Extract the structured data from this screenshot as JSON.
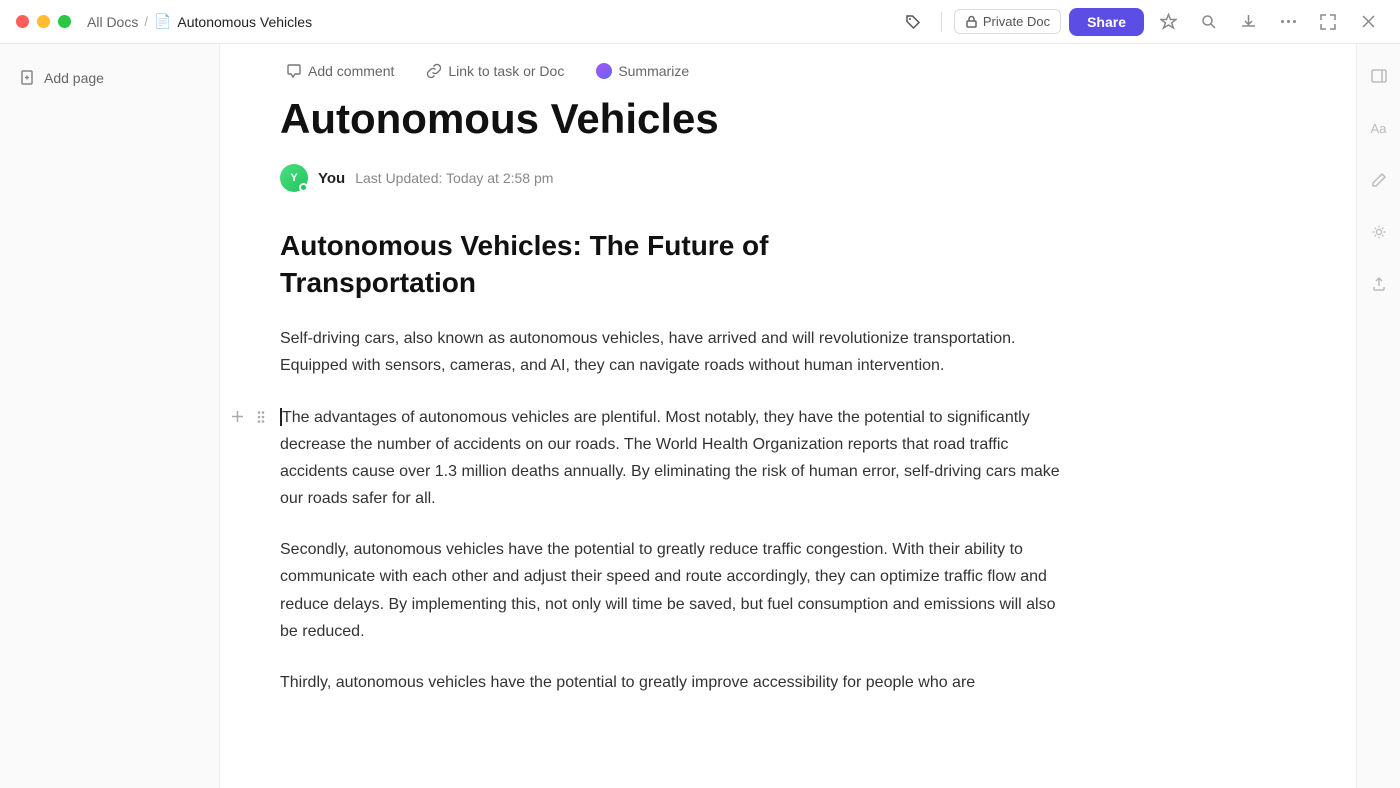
{
  "titlebar": {
    "breadcrumb_home": "All Docs",
    "breadcrumb_sep": "/",
    "doc_title": "Autonomous Vehicles",
    "private_doc_label": "Private Doc",
    "share_label": "Share"
  },
  "toolbar": {
    "add_comment": "Add comment",
    "link_to_task": "Link to task or Doc",
    "summarize": "Summarize"
  },
  "sidebar": {
    "add_page_label": "Add page"
  },
  "doc": {
    "title": "Autonomous Vehicles",
    "author": "You",
    "last_updated": "Last Updated: Today at 2:58 pm",
    "section_heading_line1": "Autonomous Vehicles: The Future of",
    "section_heading_line2": "Transportation",
    "paragraph1": "Self-driving cars, also known as autonomous vehicles, have arrived and will revolutionize transportation. Equipped with sensors, cameras, and AI, they can navigate roads without human intervention.",
    "paragraph2": "The advantages of autonomous vehicles are plentiful. Most notably, they have the potential to significantly decrease the number of accidents on our roads. The World Health Organization reports that road traffic accidents cause over 1.3 million deaths annually. By eliminating the risk of human error, self-driving cars make our roads safer for all.",
    "paragraph3": "Secondly, autonomous vehicles have the potential to greatly reduce traffic congestion. With their ability to communicate with each other and adjust their speed and route accordingly, they can optimize traffic flow and reduce delays. By implementing this, not only will time be saved, but fuel consumption and emissions will also be reduced.",
    "paragraph4": "Thirdly, autonomous vehicles have the potential to greatly improve accessibility for people who are"
  },
  "icons": {
    "add_comment_icon": "💬",
    "link_icon": "↗",
    "star_icon": "☆",
    "search_icon": "⌕",
    "export_icon": "⬇",
    "more_icon": "···",
    "fullscreen_icon": "⛶",
    "close_icon": "✕",
    "lock_icon": "🔒",
    "add_icon": "+",
    "drag_icon": "⠿",
    "indent_icon": "⇥",
    "font_icon": "Aa",
    "sparkle_icon": "✦",
    "upload_icon": "↑"
  }
}
